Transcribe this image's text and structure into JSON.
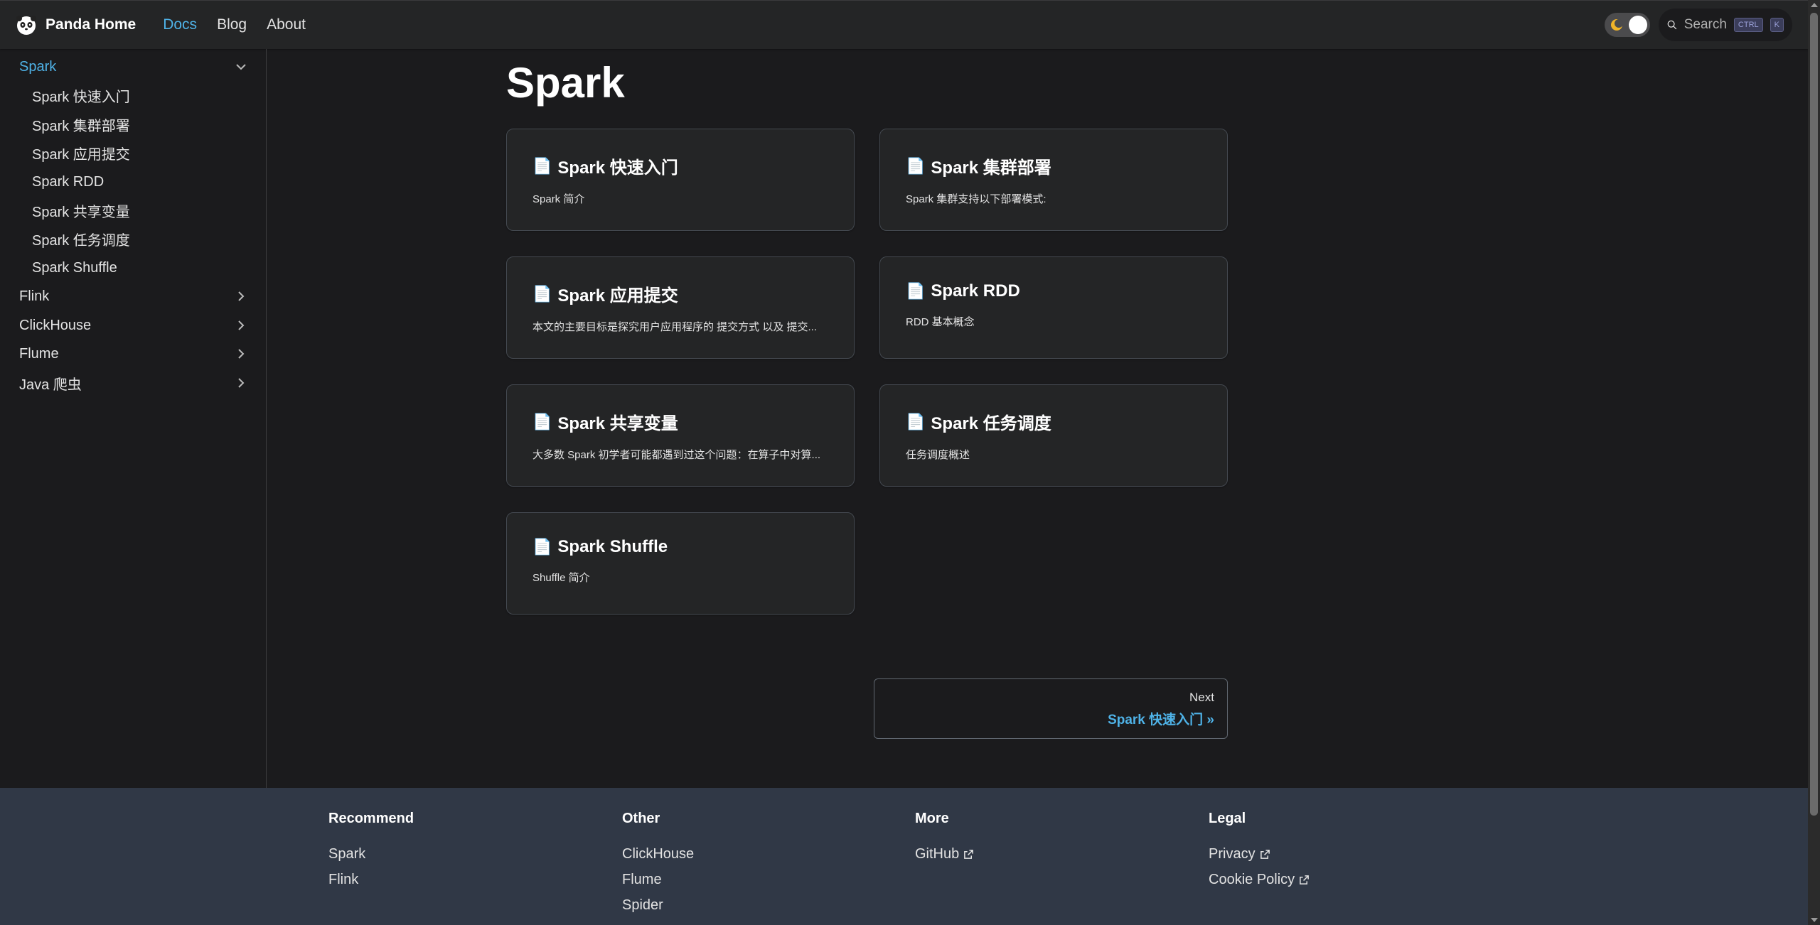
{
  "navbar": {
    "brand": "Panda Home",
    "links": [
      "Docs",
      "Blog",
      "About"
    ],
    "search_label": "Search",
    "kbd": [
      "CTRL",
      "K"
    ]
  },
  "sidebar": {
    "items": [
      {
        "label": "Spark",
        "expanded": true
      },
      {
        "label": "Spark 快速入门"
      },
      {
        "label": "Spark 集群部署"
      },
      {
        "label": "Spark 应用提交"
      },
      {
        "label": "Spark RDD"
      },
      {
        "label": "Spark 共享变量"
      },
      {
        "label": "Spark 任务调度"
      },
      {
        "label": "Spark Shuffle"
      },
      {
        "label": "Flink"
      },
      {
        "label": "ClickHouse"
      },
      {
        "label": "Flume"
      },
      {
        "label": "Java 爬虫"
      }
    ]
  },
  "main": {
    "title": "Spark",
    "cards": [
      {
        "title": "Spark 快速入门",
        "desc": "Spark 简介",
        "icon": "📄"
      },
      {
        "title": "Spark 集群部署",
        "desc": "Spark 集群支持以下部署模式:",
        "icon": "📄"
      },
      {
        "title": "Spark 应用提交",
        "desc": "本文的主要目标是探究用户应用程序的 提交方式 以及 提交...",
        "icon": "📄"
      },
      {
        "title": "Spark RDD",
        "desc": "RDD 基本概念",
        "icon": "📄"
      },
      {
        "title": "Spark 共享变量",
        "desc": "大多数 Spark 初学者可能都遇到过这个问题：在算子中对算...",
        "icon": "📄"
      },
      {
        "title": "Spark 任务调度",
        "desc": "任务调度概述",
        "icon": "📄"
      },
      {
        "title": "Spark Shuffle",
        "desc": "Shuffle 简介",
        "icon": "📄"
      }
    ],
    "pager": {
      "sub": "Next",
      "label": "Spark 快速入门 »"
    }
  },
  "footer": {
    "columns": [
      {
        "title": "Recommend",
        "links": [
          {
            "label": "Spark"
          },
          {
            "label": "Flink"
          }
        ]
      },
      {
        "title": "Other",
        "links": [
          {
            "label": "ClickHouse"
          },
          {
            "label": "Flume"
          },
          {
            "label": "Spider"
          }
        ]
      },
      {
        "title": "More",
        "links": [
          {
            "label": "GitHub",
            "external": true
          }
        ]
      },
      {
        "title": "Legal",
        "links": [
          {
            "label": "Privacy",
            "external": true
          },
          {
            "label": "Cookie Policy",
            "external": true
          }
        ]
      }
    ]
  },
  "colors": {
    "accent": "#4fb3e8",
    "background": "#1b1b1d",
    "navbar": "#242526",
    "footer": "#303846"
  }
}
